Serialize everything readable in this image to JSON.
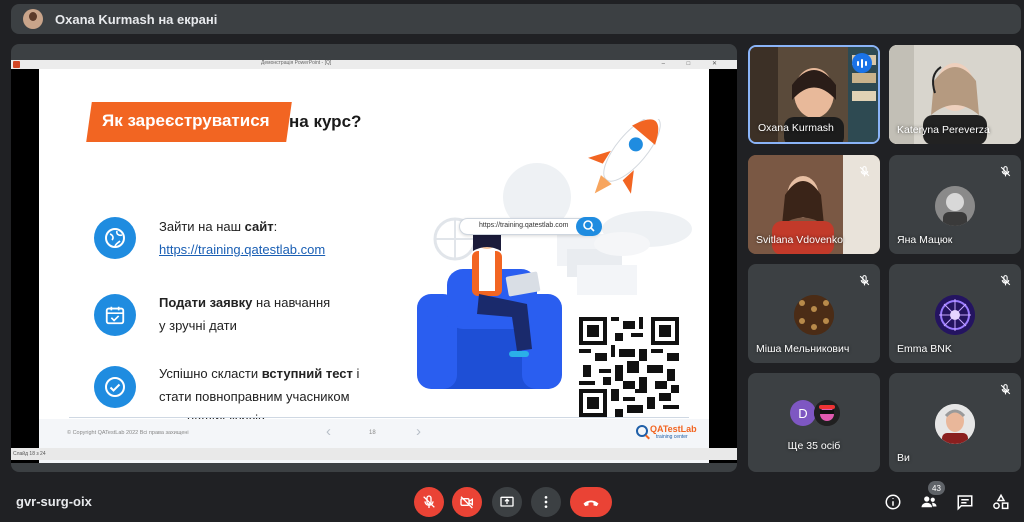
{
  "banner": {
    "title": "Oxana Kurmash на екрані"
  },
  "presentation": {
    "window_title": "Демонстрація PowerPoint - [Q]",
    "status_text": "Слайд 18 з 24",
    "slide": {
      "title_highlight": "Як зареєструватися",
      "title_rest": "на курс?",
      "step1_line1_a": "Зайти на наш ",
      "step1_line1_b": "сайт",
      "step1_line1_c": ":",
      "step1_link": "https://training.qatestlab.com",
      "step2_bold1": "Подати заявку",
      "step2_rest1": " на навчання",
      "step2_line2": "у зручні дати",
      "step3_a": "Успішно скласти ",
      "step3_bold": "вступний тест",
      "step3_c": " і",
      "step3_line2": "стати повноправним учасником",
      "step3_line3": "наших курсів",
      "search_url": "https://training.qatestlab.com",
      "copyright": "© Copyright QATestLab 2022 Всі права захищені",
      "page_number": "18",
      "brand_name": "QATestLab",
      "brand_sub": "training center"
    }
  },
  "participants": [
    {
      "name": "Oxana Kurmash",
      "speaking": true
    },
    {
      "name": "Kateryna Pereverza",
      "muted": false
    },
    {
      "name": "Svitlana Vdovenko",
      "muted": true
    },
    {
      "name": "Яна Мацюк",
      "muted": true
    },
    {
      "name": "Міша Мельникович",
      "muted": true
    },
    {
      "name": "Emma BNK",
      "muted": true
    },
    {
      "name": "Ще 35 осіб",
      "avatar_letter": "D"
    },
    {
      "name": "Ви",
      "muted": true
    }
  ],
  "bottom_bar": {
    "meeting_code": "gvr-surg-oix",
    "participants_count": "43"
  },
  "colors": {
    "accent_red": "#ea4335",
    "slide_orange": "#f26522",
    "slide_blue": "#1f8ce0"
  }
}
